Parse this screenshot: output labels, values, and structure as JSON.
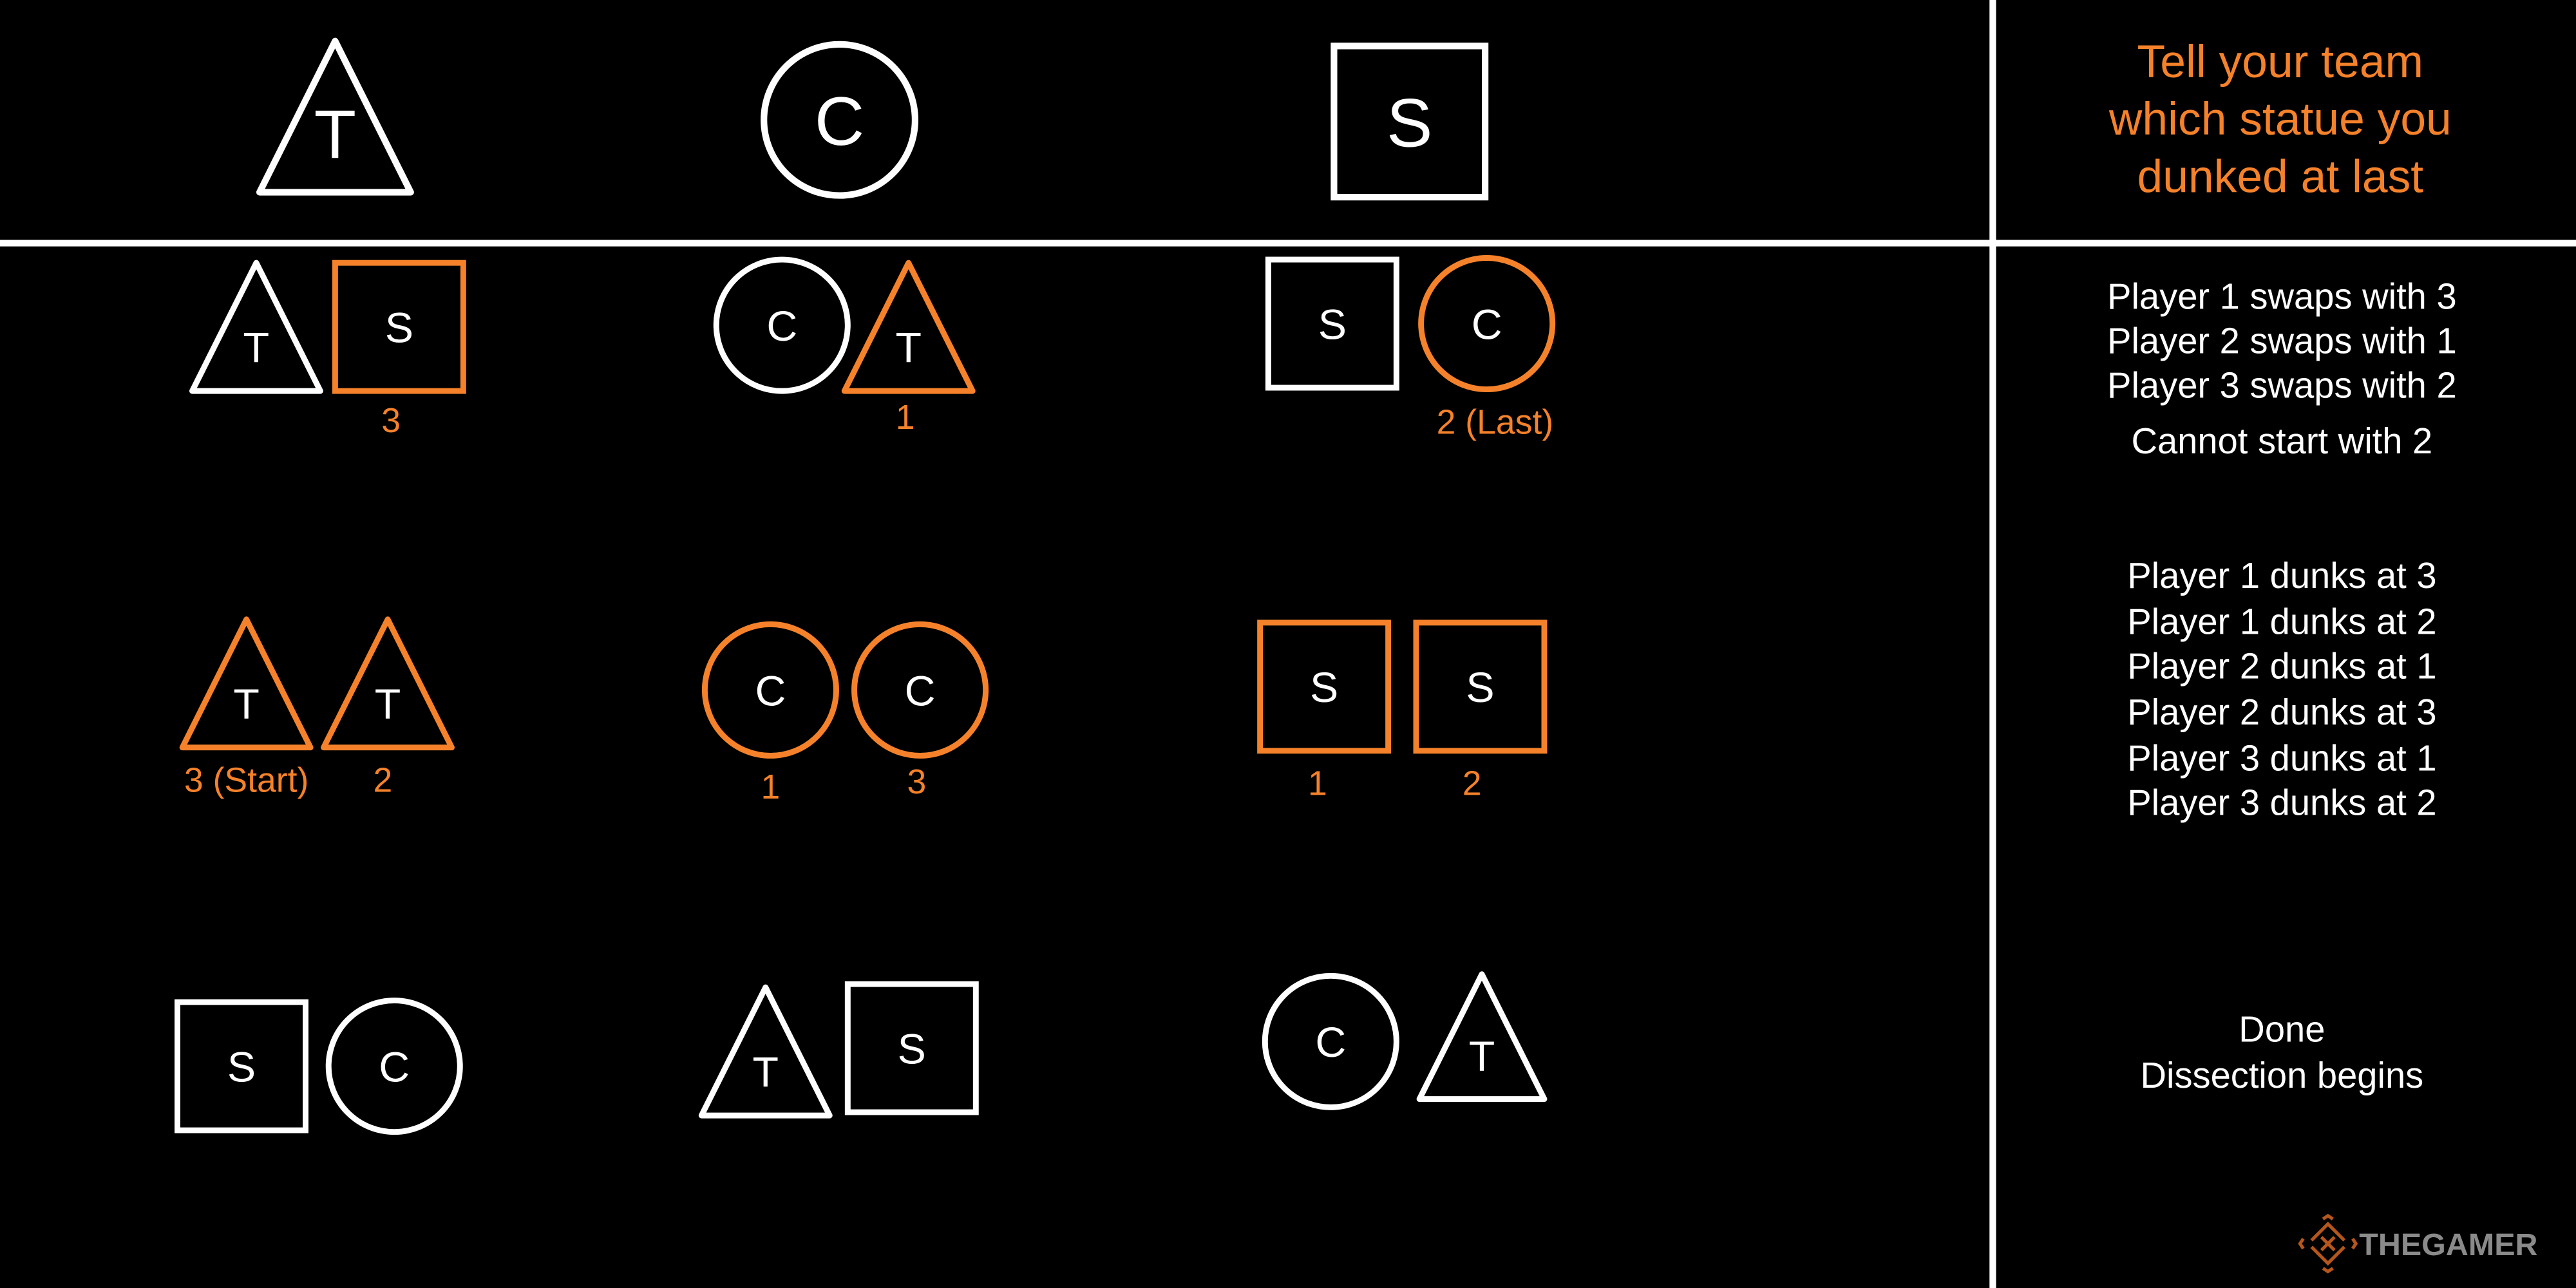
{
  "colors": {
    "background": "#000000",
    "white": "#ffffff",
    "orange": "#f5822a",
    "logo_gray": "#8a8a8a"
  },
  "header": {
    "statues": [
      {
        "shape": "triangle",
        "letter": "T"
      },
      {
        "shape": "circle",
        "letter": "C"
      },
      {
        "shape": "square",
        "letter": "S"
      }
    ],
    "instruction_lines": [
      "Tell your team",
      "which statue you",
      "dunked at last"
    ]
  },
  "rows": [
    [
      [
        {
          "shape": "triangle",
          "letter": "T",
          "color": "white",
          "label": ""
        },
        {
          "shape": "square",
          "letter": "S",
          "color": "orange",
          "label": "3"
        }
      ],
      [
        {
          "shape": "circle",
          "letter": "C",
          "color": "white",
          "label": ""
        },
        {
          "shape": "triangle",
          "letter": "T",
          "color": "orange",
          "label": "1"
        }
      ],
      [
        {
          "shape": "square",
          "letter": "S",
          "color": "white",
          "label": ""
        },
        {
          "shape": "circle",
          "letter": "C",
          "color": "orange",
          "label": "2 (Last)"
        }
      ]
    ],
    [
      [
        {
          "shape": "triangle",
          "letter": "T",
          "color": "orange",
          "label": "3 (Start)"
        },
        {
          "shape": "triangle",
          "letter": "T",
          "color": "orange",
          "label": "2"
        }
      ],
      [
        {
          "shape": "circle",
          "letter": "C",
          "color": "orange",
          "label": "1"
        },
        {
          "shape": "circle",
          "letter": "C",
          "color": "orange",
          "label": "3"
        }
      ],
      [
        {
          "shape": "square",
          "letter": "S",
          "color": "orange",
          "label": "1"
        },
        {
          "shape": "square",
          "letter": "S",
          "color": "orange",
          "label": "2"
        }
      ]
    ],
    [
      [
        {
          "shape": "square",
          "letter": "S",
          "color": "white",
          "label": ""
        },
        {
          "shape": "circle",
          "letter": "C",
          "color": "white",
          "label": ""
        }
      ],
      [
        {
          "shape": "triangle",
          "letter": "T",
          "color": "white",
          "label": ""
        },
        {
          "shape": "square",
          "letter": "S",
          "color": "white",
          "label": ""
        }
      ],
      [
        {
          "shape": "circle",
          "letter": "C",
          "color": "white",
          "label": ""
        },
        {
          "shape": "triangle",
          "letter": "T",
          "color": "white",
          "label": ""
        }
      ]
    ]
  ],
  "notes": [
    [
      "Player 1 swaps with 3",
      "Player 2 swaps with 1",
      "Player 3 swaps with 2",
      "Cannot start with 2"
    ],
    [
      "Player 1 dunks at 3",
      "Player 1 dunks at 2",
      "Player 2 dunks at 1",
      "Player 2 dunks at 3",
      "Player 3 dunks at 1",
      "Player 3 dunks at 2"
    ],
    [
      "Done",
      "Dissection begins"
    ]
  ],
  "watermark": {
    "text": "THEGAMER",
    "icon": "thegamer-logo-icon"
  }
}
